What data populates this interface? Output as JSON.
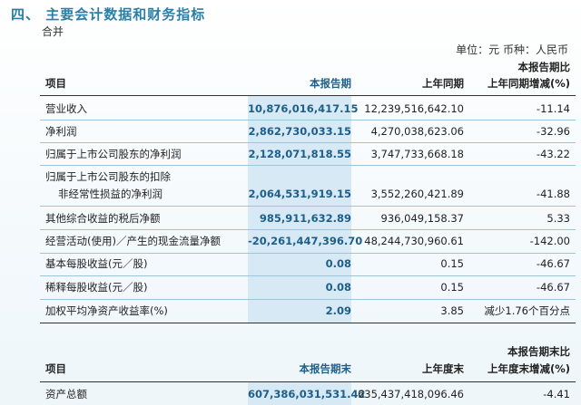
{
  "section_title": "四、 主要会计数据和财务指标",
  "subtitle": "合并",
  "unit_line": "单位：元   币种：人民币",
  "table1": {
    "header": {
      "item": "项目",
      "current": "本报告期",
      "prior": "上年同期",
      "change_top": "本报告期比",
      "change": "上年同期增减(%)"
    },
    "rows": [
      {
        "label": "营业收入",
        "current": "10,876,016,417.15",
        "prior": "12,239,516,642.10",
        "change": "-11.14"
      },
      {
        "label": "净利润",
        "current": "2,862,730,033.15",
        "prior": "4,270,038,623.06",
        "change": "-32.96"
      },
      {
        "label": "归属于上市公司股东的净利润",
        "current": "2,128,071,818.55",
        "prior": "3,747,733,668.18",
        "change": "-43.22"
      },
      {
        "label_line1": "归属于上市公司股东的扣除",
        "label_line2": "非经常性损益的净利润",
        "current": "2,064,531,919.15",
        "prior": "3,552,260,421.89",
        "change": "-41.88"
      },
      {
        "label": "其他综合收益的税后净额",
        "current": "985,911,632.89",
        "prior": "936,049,158.37",
        "change": "5.33"
      },
      {
        "label": "经营活动(使用)／产生的现金流量净额",
        "current": "-20,261,447,396.70",
        "prior": "48,244,730,960.61",
        "change": "-142.00"
      },
      {
        "label": "基本每股收益(元／股)",
        "current": "0.08",
        "prior": "0.15",
        "change": "-46.67"
      },
      {
        "label": "稀释每股收益(元／股)",
        "current": "0.08",
        "prior": "0.15",
        "change": "-46.67"
      },
      {
        "label": "加权平均净资产收益率(%)",
        "current": "2.09",
        "prior": "3.85",
        "change": "减少1.76个百分点"
      }
    ]
  },
  "table2": {
    "header": {
      "item": "项目",
      "current": "本报告期末",
      "prior": "上年度末",
      "change_top": "本报告期末比",
      "change": "上年度末增减(%)"
    },
    "rows": [
      {
        "label": "资产总额",
        "current": "607,386,031,531.42",
        "prior": "635,437,418,096.46",
        "change": "-4.41"
      }
    ]
  }
}
